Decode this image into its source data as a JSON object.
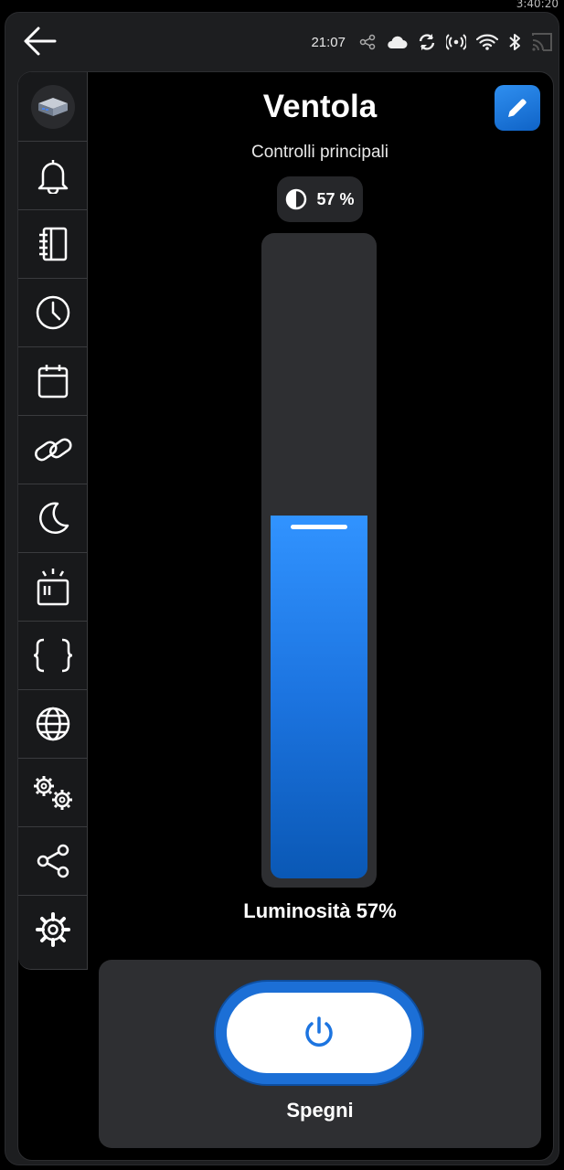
{
  "corner_text": "3:40:20",
  "status_bar": {
    "time": "21:07",
    "icons": [
      "share-icon",
      "cloud-icon",
      "sync-icon",
      "hotspot-icon",
      "wifi-icon",
      "bluetooth-icon",
      "cast-icon"
    ]
  },
  "page": {
    "title": "Ventola",
    "subtitle": "Controlli principali",
    "accent": "#1c74e0"
  },
  "brightness": {
    "chip_text": "57 %",
    "label": "Luminosità 57%",
    "value": 57
  },
  "power": {
    "label": "Spegni"
  },
  "sidebar": {
    "items": [
      {
        "icon": "bell-icon"
      },
      {
        "icon": "notebook-icon"
      },
      {
        "icon": "clock-icon"
      },
      {
        "icon": "calendar-icon"
      },
      {
        "icon": "link-icon"
      },
      {
        "icon": "moon-icon"
      },
      {
        "icon": "alarm-light-icon"
      },
      {
        "icon": "code-braces-icon"
      },
      {
        "icon": "globe-icon"
      },
      {
        "icon": "cogs-icon"
      },
      {
        "icon": "share-icon"
      },
      {
        "icon": "settings-icon"
      }
    ]
  }
}
